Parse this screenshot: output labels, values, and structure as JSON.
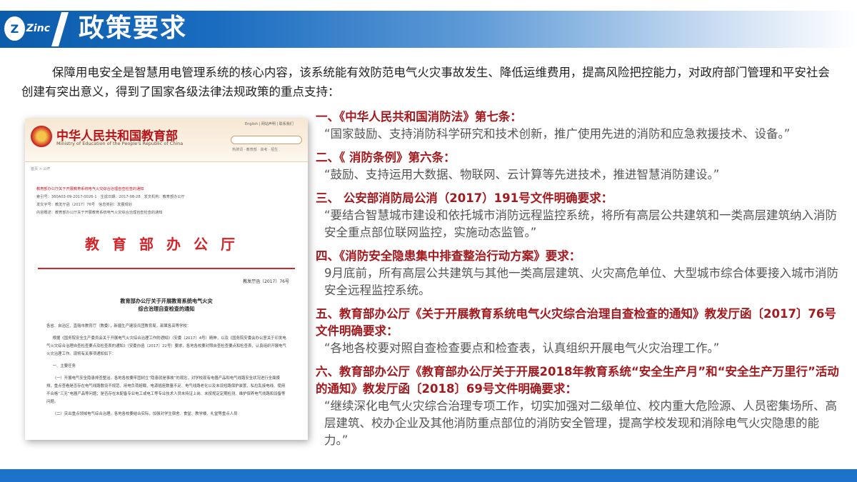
{
  "header": {
    "logo_text": "Zinc",
    "title": "政策要求"
  },
  "intro": "保障用电安全是智慧用电管理系统的核心内容，该系统能有效防范电气火灾事故发生、降低运维费用，提高风险把控能力，对政府部门管理和平安社会创建有突出意义，得到了国家各级法律法规政策的重点支持：",
  "document": {
    "ministry_name": "中华人民共和国教育部",
    "ministry_en": "Ministry of Education of the People's Republic of China",
    "links": "English | 网站声明 | 联系我们",
    "hot": "热搜词 · 教育部 · 高考 · 招生",
    "breadcrumb": "首页 > 公开",
    "meta": [
      {
        "label": "索引号：",
        "value": "360A03-09-2017-0026-1",
        "label2": "生成日期：",
        "value2": "2017-08-28",
        "label3": "发文机构：",
        "value3": "教育部办公厅"
      },
      {
        "label": "发文字号：",
        "value": "教发厅函〔2017〕76号",
        "label2": "信息类别：",
        "value2": "发展规划"
      },
      {
        "label": "内容概述：",
        "value": "教育部办公厅关于开展教育系统电气火灾综合治理自查检查的通知"
      }
    ],
    "meta_title": "教育部办公厅关于开展教育系统电气火灾综合治理自查检查的通知",
    "heading": "教育部办公厅",
    "doc_number": "教发厅函〔2017〕76号",
    "subject_line1": "教育部办公厅关于开展教育系统电气火灾",
    "subject_line2": "综合治理自查检查的通知",
    "body": [
      "各省、自治区、直辖市教育厅（教委），新疆生产建设兵团教育局，部属各高等学校：",
      "根据《国务院安全生产委员会关于开展电气火灾综合治理工作的通知》（安委〔2017〕4号）精神，以及《国务院安委会办公室关于印发电气火灾综合治理自查检查要点及检查表的通知》（安委办函〔2017〕22号）要求，各地各校要对照自查检查要点和检查表，认真组织开展电气火灾治理工作。现将有关事项通知如下：",
      "一、主要任务",
      "（一）开展电气安全隐患排查整治。各地各校要牢固树立“隐患就是事故”的观念，对学校现有电器产品和电气线路安全状况进行全面摸排，重点查看是否存在电气线路敷设不规范、用电负荷超载、电源插座数量不足、电气线路老化以及未设短路保护装置、私拉乱接电线、使用不合格“三无”电器产品等问题；是否存在未配备专业电工或电工等专业技术人员未持证上岗、未按规定定期检测、维护保养电气线路和设备等问题。",
      "（二）突出重点领域电气综合治理。各地各校要结合实际，加强对学生宿舍、食堂、教学楼、礼堂等重点人员"
    ]
  },
  "sections": [
    {
      "title": "一、《中华人民共和国消防法》第七条：",
      "quote": "“国家鼓励、支持消防科学研究和技术创新，推广使用先进的消防和应急救援技术、设备。”"
    },
    {
      "title": "二、《 消防条例》第六条：",
      "quote": "“鼓励、支持运用大数据、物联网、云计算等先进技术，推进智慧消防建设。”"
    },
    {
      "title": "三、 公安部消防局公消（2017）191号文件明确要求：",
      "quote": "“要结合智慧城市建设和依托城市消防远程监控系统，将所有高层公共建筑和一类高层建筑纳入消防安全重点部位联网监控，实施动态监管。”"
    },
    {
      "title": "四、《消防安全隐患集中排查整治行动方案》要求：",
      "quote": "9月底前，所有高层公共建筑与其他一类高层建筑、火灾高危单位、大型城市综合体要接入城市消防安全远程监控系统。"
    },
    {
      "title": "五、教育部办公厅《关于开展教育系统电气火灾综合治理自查检查的通知》教发厅函〔2017〕76号文件明确要求：",
      "quote": "“各地各校要对照自查检查要点和检查表，认真组织开展电气火灾治理工作。”"
    },
    {
      "title": "六、教育部办公厅《教育部办公厅关于开展2018年教育系统“安全生产月”和“安全生产万里行”活动的通知》教发厅函〔2018〕69号文件明确要求：",
      "quote": "“继续深化电气火灾综合治理专项工作，切实加强对二级单位、校内重大危险源、人员密集场所、高层建筑、校办企业及其他消防重点部位的消防安全管理，提高学校发现和消除电气火灾隐患的能力。”"
    }
  ],
  "colors": {
    "header_blue": "#0b5cab",
    "section_title": "#a31a1e",
    "quote_text": "#555555",
    "footer_blue": "#1d73c9"
  }
}
